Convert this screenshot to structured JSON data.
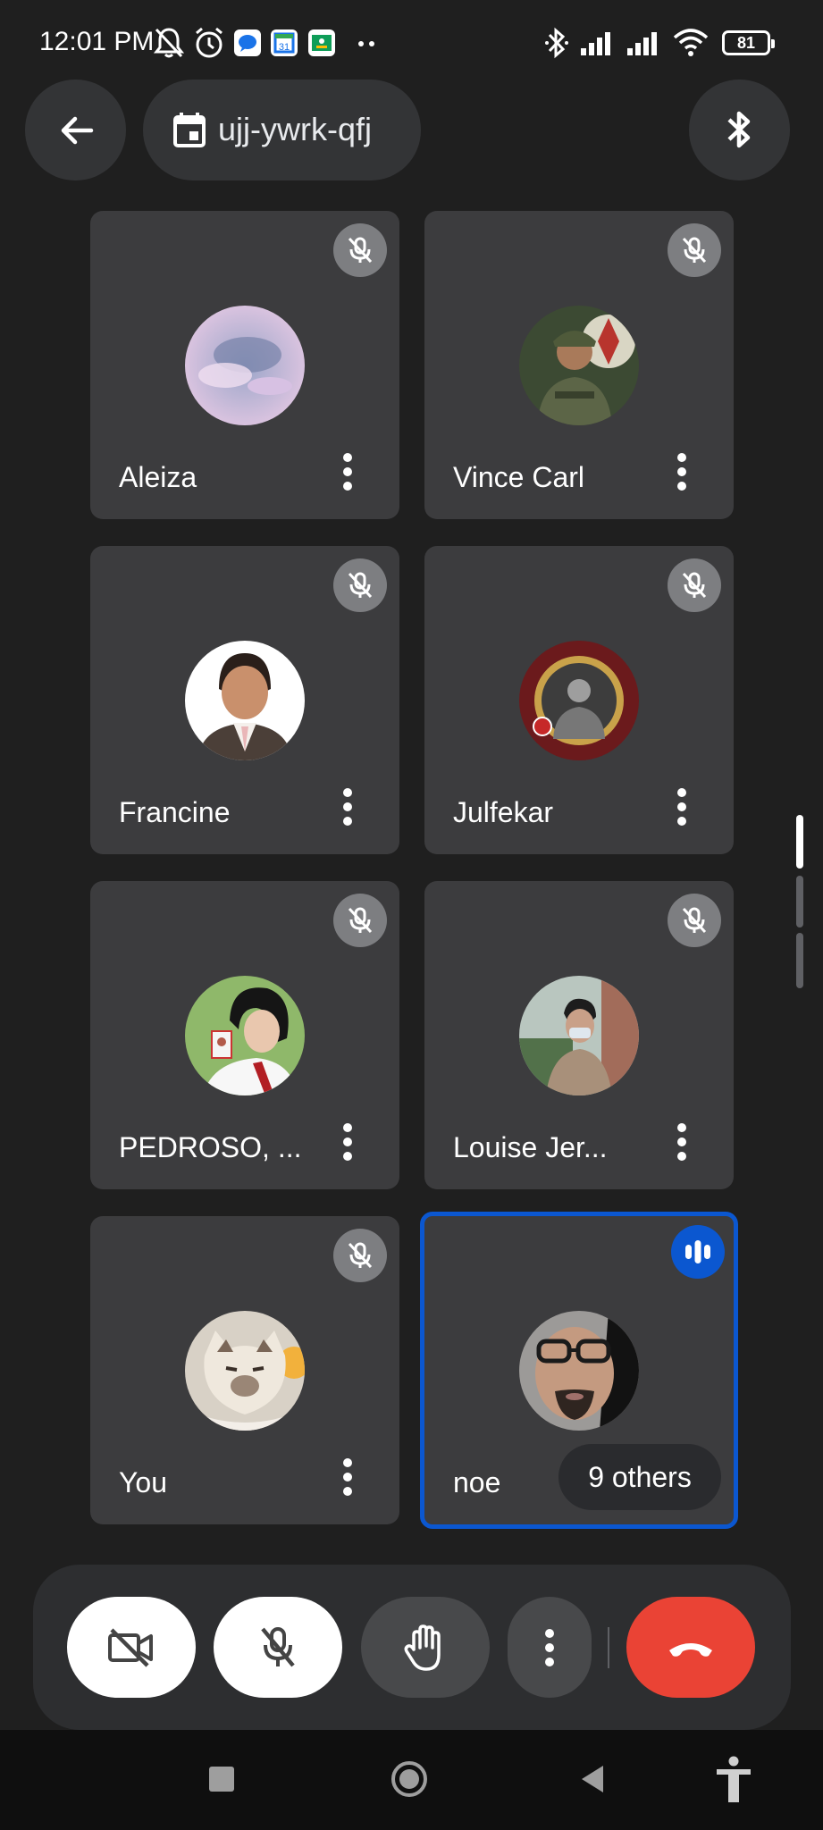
{
  "status_bar": {
    "time": "12:01 PM",
    "battery_level": "81",
    "icons": [
      "mute-bell-icon",
      "alarm-icon",
      "messages-icon",
      "calendar-icon",
      "classroom-icon",
      "more-notifications-icon",
      "bluetooth-icon",
      "signal-icon",
      "signal-icon",
      "wifi-icon",
      "battery-icon"
    ]
  },
  "top_bar": {
    "meeting_code": "ujj-ywrk-qfj"
  },
  "participants": [
    {
      "name": "Aleiza",
      "muted": true
    },
    {
      "name": "Vince Carl",
      "muted": true
    },
    {
      "name": "Francine",
      "muted": true
    },
    {
      "name": "Julfekar",
      "muted": true
    },
    {
      "name": "PEDROSO, ...",
      "muted": true
    },
    {
      "name": "Louise Jer...",
      "muted": true
    },
    {
      "name": "You",
      "muted": true
    },
    {
      "name": "noe",
      "muted": false,
      "speaking": true
    }
  ],
  "others_pill": "9 others",
  "controls": {
    "camera": "camera-off-icon",
    "mic": "mic-off-icon",
    "raise_hand": "hand-icon",
    "more": "more-vert-icon",
    "leave": "end-call-icon"
  },
  "colors": {
    "background": "#1f1f1f",
    "tile": "#3c3c3e",
    "active_border": "#0b57d0",
    "end_call": "#ea4335"
  }
}
